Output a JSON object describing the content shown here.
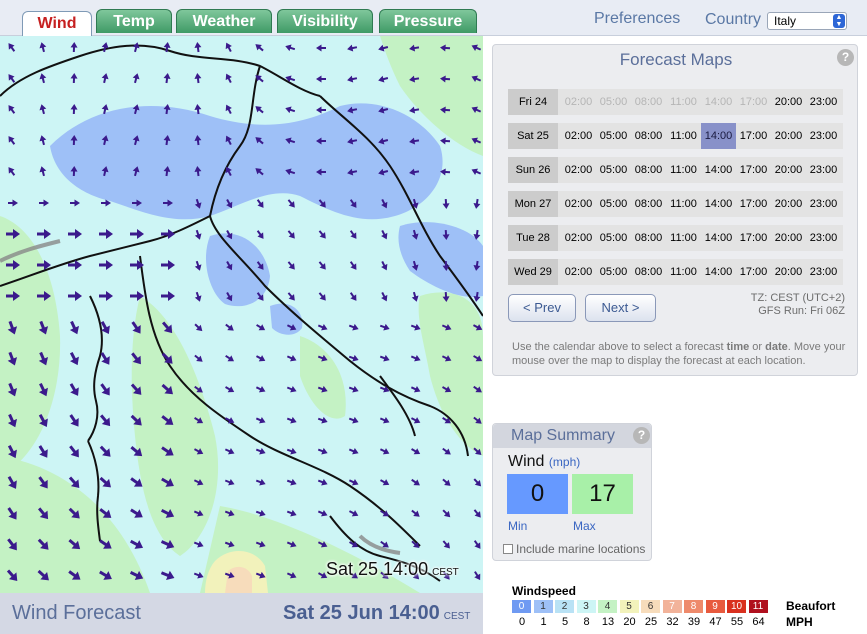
{
  "tabs": [
    {
      "label": "Wind",
      "active": true
    },
    {
      "label": "Temp",
      "active": false
    },
    {
      "label": "Weather",
      "active": false
    },
    {
      "label": "Visibility",
      "active": false
    },
    {
      "label": "Pressure",
      "active": false
    }
  ],
  "header": {
    "preferences_label": "Preferences",
    "country_label": "Country",
    "country_value": "Italy"
  },
  "map": {
    "overlay_time": "Sat 25 14:00",
    "overlay_tz": "CEST"
  },
  "footer": {
    "title": "Wind Forecast",
    "date": "Sat 25 Jun 14:00",
    "tz": "CEST"
  },
  "forecast": {
    "title": "Forecast Maps",
    "help": "?",
    "times": [
      "02:00",
      "05:00",
      "08:00",
      "11:00",
      "14:00",
      "17:00",
      "20:00",
      "23:00"
    ],
    "days": [
      {
        "label": "Fri 24",
        "past_count": 6
      },
      {
        "label": "Sat 25",
        "past_count": 0,
        "selected_index": 4
      },
      {
        "label": "Sun 26",
        "past_count": 0
      },
      {
        "label": "Mon 27",
        "past_count": 0
      },
      {
        "label": "Tue 28",
        "past_count": 0
      },
      {
        "label": "Wed 29",
        "past_count": 0
      }
    ],
    "prev_label": "< Prev",
    "next_label": "Next >",
    "tz_info": "TZ: CEST (UTC+2)",
    "run_info": "GFS Run: Fri 06Z",
    "instructions_pre": "Use the calendar above to select a forecast ",
    "instructions_time": "time",
    "instructions_mid": " or ",
    "instructions_date": "date",
    "instructions_post": ". Move your mouse over the map to display the forecast at each location."
  },
  "summary": {
    "title": "Map Summary",
    "help": "?",
    "variable": "Wind",
    "unit": "(mph)",
    "min_value": "0",
    "max_value": "17",
    "min_label": "Min",
    "max_label": "Max",
    "min_color": "#6699ff",
    "max_color": "#a8f0a8",
    "include_marine_label": "Include marine locations",
    "include_marine_checked": false
  },
  "legend": {
    "title": "Windspeed",
    "beaufort_label": "Beaufort",
    "mph_label": "MPH",
    "beaufort": [
      "0",
      "1",
      "2",
      "3",
      "4",
      "5",
      "6",
      "7",
      "8",
      "9",
      "10",
      "11"
    ],
    "colors": [
      "#6f9af2",
      "#9ec0f7",
      "#b9e2f5",
      "#cdf5f5",
      "#c4f2c4",
      "#f2f2bb",
      "#f7dcbb",
      "#f2b39a",
      "#ee8a6b",
      "#e85a3e",
      "#d9301e",
      "#b0101e"
    ],
    "mph": [
      "0",
      "1",
      "5",
      "8",
      "13",
      "20",
      "25",
      "32",
      "39",
      "47",
      "55",
      "64"
    ]
  },
  "colors": {
    "accent": "#5b6f9a",
    "tab_green": "#3f9a66",
    "active_tab_text": "#c62020",
    "selected_cell": "#8891c9",
    "arrow": "#3b1a8c"
  }
}
